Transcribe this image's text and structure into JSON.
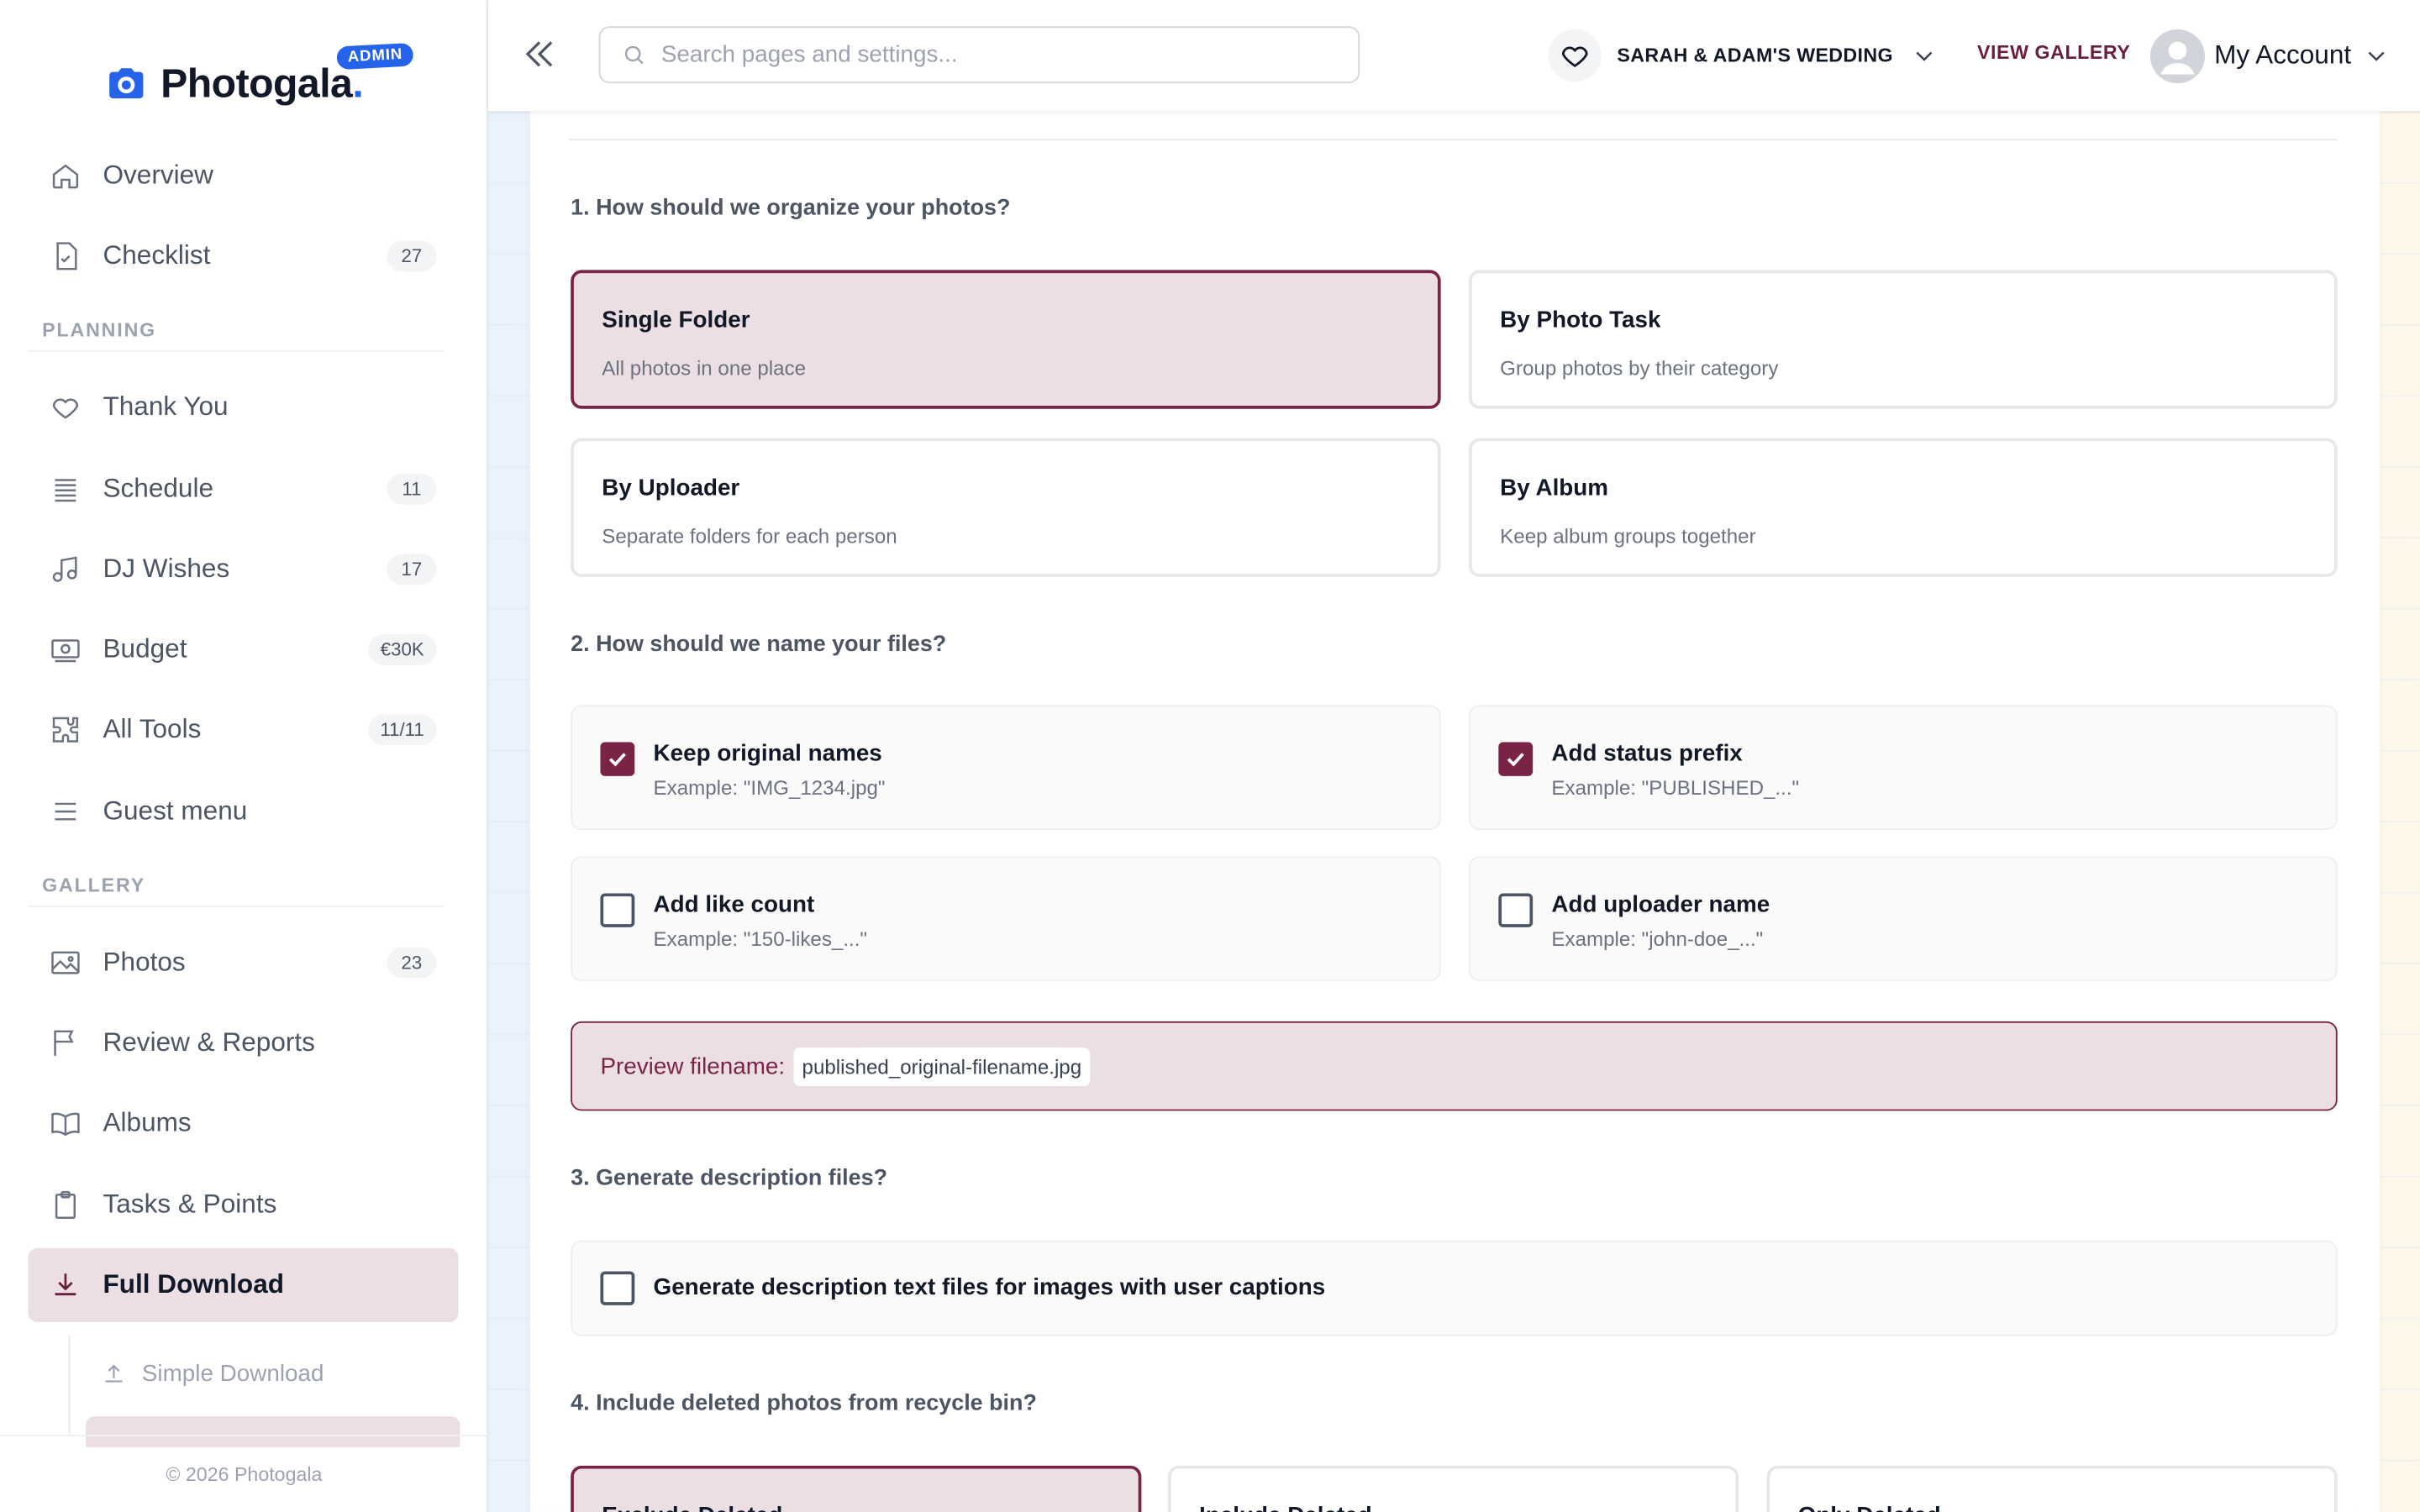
{
  "brand": {
    "name": "Photogala",
    "dot": ".",
    "admin_badge": "ADMIN"
  },
  "sidebar": {
    "items_top": [
      {
        "label": "Overview",
        "icon": "home-icon",
        "badge": ""
      },
      {
        "label": "Checklist",
        "icon": "checklist-icon",
        "badge": "27"
      }
    ],
    "planning_label": "PLANNING",
    "planning": [
      {
        "label": "Thank You",
        "icon": "heart-icon",
        "badge": ""
      },
      {
        "label": "Schedule",
        "icon": "schedule-icon",
        "badge": "11"
      },
      {
        "label": "DJ Wishes",
        "icon": "music-icon",
        "badge": "17"
      },
      {
        "label": "Budget",
        "icon": "money-icon",
        "badge": "€30K"
      },
      {
        "label": "All Tools",
        "icon": "puzzle-icon",
        "badge": "11/11"
      },
      {
        "label": "Guest menu",
        "icon": "menu-icon",
        "badge": ""
      }
    ],
    "gallery_label": "GALLERY",
    "gallery": [
      {
        "label": "Photos",
        "icon": "image-icon",
        "badge": "23"
      },
      {
        "label": "Review & Reports",
        "icon": "flag-icon",
        "badge": ""
      },
      {
        "label": "Albums",
        "icon": "book-icon",
        "badge": ""
      },
      {
        "label": "Tasks & Points",
        "icon": "clipboard-icon",
        "badge": ""
      },
      {
        "label": "Full Download",
        "icon": "download-icon",
        "badge": ""
      }
    ],
    "sub_items": [
      {
        "label": "Simple Download",
        "icon": "upload-icon"
      }
    ],
    "footer": "© 2026 Photogala"
  },
  "header": {
    "search_placeholder": "Search pages and settings...",
    "event_name": "SARAH & ADAM'S WEDDING",
    "view_gallery": "VIEW GALLERY",
    "account": "My Account"
  },
  "main": {
    "q1": "1. How should we organize your photos?",
    "organize_options": [
      {
        "title": "Single Folder",
        "desc": "All photos in one place",
        "selected": true
      },
      {
        "title": "By Photo Task",
        "desc": "Group photos by their category",
        "selected": false
      },
      {
        "title": "By Uploader",
        "desc": "Separate folders for each person",
        "selected": false
      },
      {
        "title": "By Album",
        "desc": "Keep album groups together",
        "selected": false
      }
    ],
    "q2": "2. How should we name your files?",
    "name_options": [
      {
        "title": "Keep original names",
        "desc": "Example: \"IMG_1234.jpg\"",
        "checked": true
      },
      {
        "title": "Add status prefix",
        "desc": "Example: \"PUBLISHED_...\"",
        "checked": true
      },
      {
        "title": "Add like count",
        "desc": "Example: \"150-likes_...\"",
        "checked": false
      },
      {
        "title": "Add uploader name",
        "desc": "Example: \"john-doe_...\"",
        "checked": false
      }
    ],
    "preview_label": "Preview filename:",
    "preview_value": "published_original-filename.jpg",
    "q3": "3. Generate description files?",
    "description_option": {
      "title": "Generate description text files for images with user captions",
      "checked": false
    },
    "q4": "4. Include deleted photos from recycle bin?",
    "deleted_options": [
      {
        "title": "Exclude Deleted",
        "selected": true
      },
      {
        "title": "Include Deleted",
        "selected": false
      },
      {
        "title": "Only Deleted",
        "selected": false
      }
    ]
  },
  "colors": {
    "accent": "#7a2346",
    "brand_blue": "#2563eb",
    "selected_bg": "#ecdfe4"
  }
}
